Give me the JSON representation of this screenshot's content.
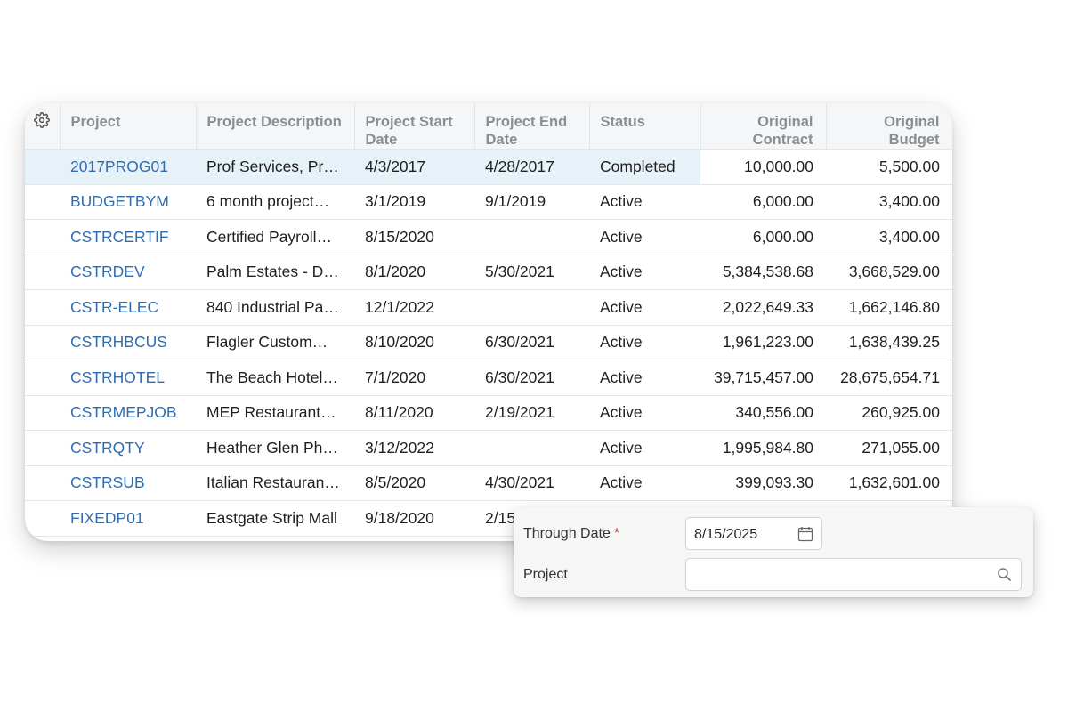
{
  "grid": {
    "columns": [
      {
        "key": "project",
        "label": "Project"
      },
      {
        "key": "description",
        "label": "Project Description"
      },
      {
        "key": "start",
        "label": "Project Start Date"
      },
      {
        "key": "end",
        "label": "Project End Date"
      },
      {
        "key": "status",
        "label": "Status"
      },
      {
        "key": "contract",
        "label": "Original Contract"
      },
      {
        "key": "budget",
        "label": "Original Budget"
      }
    ],
    "rows": [
      {
        "project": "2017PROG01",
        "description": "Prof Services, Pr…",
        "start": "4/3/2017",
        "end": "4/28/2017",
        "status": "Completed",
        "contract": "10,000.00",
        "budget": "5,500.00"
      },
      {
        "project": "BUDGETBYM",
        "description": "6 month project…",
        "start": "3/1/2019",
        "end": "9/1/2019",
        "status": "Active",
        "contract": "6,000.00",
        "budget": "3,400.00"
      },
      {
        "project": "CSTRCERTIF",
        "description": "Certified Payroll…",
        "start": "8/15/2020",
        "end": "",
        "status": "Active",
        "contract": "6,000.00",
        "budget": "3,400.00"
      },
      {
        "project": "CSTRDEV",
        "description": "Palm Estates - D…",
        "start": "8/1/2020",
        "end": "5/30/2021",
        "status": "Active",
        "contract": "5,384,538.68",
        "budget": "3,668,529.00"
      },
      {
        "project": "CSTR-ELEC",
        "description": "840 Industrial Pa…",
        "start": "12/1/2022",
        "end": "",
        "status": "Active",
        "contract": "2,022,649.33",
        "budget": "1,662,146.80"
      },
      {
        "project": "CSTRHBCUS",
        "description": "Flagler Custom…",
        "start": "8/10/2020",
        "end": "6/30/2021",
        "status": "Active",
        "contract": "1,961,223.00",
        "budget": "1,638,439.25"
      },
      {
        "project": "CSTRHOTEL",
        "description": "The Beach Hotel…",
        "start": "7/1/2020",
        "end": "6/30/2021",
        "status": "Active",
        "contract": "39,715,457.00",
        "budget": "28,675,654.71"
      },
      {
        "project": "CSTRMEPJOB",
        "description": "MEP Restaurant…",
        "start": "8/11/2020",
        "end": "2/19/2021",
        "status": "Active",
        "contract": "340,556.00",
        "budget": "260,925.00"
      },
      {
        "project": "CSTRQTY",
        "description": "Heather Glen Ph…",
        "start": "3/12/2022",
        "end": "",
        "status": "Active",
        "contract": "1,995,984.80",
        "budget": "271,055.00"
      },
      {
        "project": "CSTRSUB",
        "description": "Italian Restauran…",
        "start": "8/5/2020",
        "end": "4/30/2021",
        "status": "Active",
        "contract": "399,093.30",
        "budget": "1,632,601.00"
      },
      {
        "project": "FIXEDP01",
        "description": "Eastgate Strip Mall",
        "start": "9/18/2020",
        "end": "2/15",
        "status": "",
        "contract": "",
        "budget": ""
      }
    ]
  },
  "filter": {
    "through_date_label": "Through Date",
    "required_mark": "*",
    "through_date_value": "8/15/2025",
    "project_label": "Project",
    "project_value": ""
  }
}
